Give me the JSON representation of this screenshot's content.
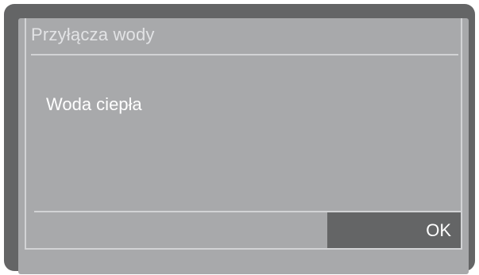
{
  "dialog": {
    "title": "Przyłącza wody",
    "message": "Woda ciepła",
    "ok_label": "OK"
  },
  "colors": {
    "frame": "#646566",
    "screen": "#a8a9ab",
    "divider": "#d2d3d5",
    "title_text": "#e2e3e5",
    "text": "#ffffff",
    "button": "#646566"
  }
}
